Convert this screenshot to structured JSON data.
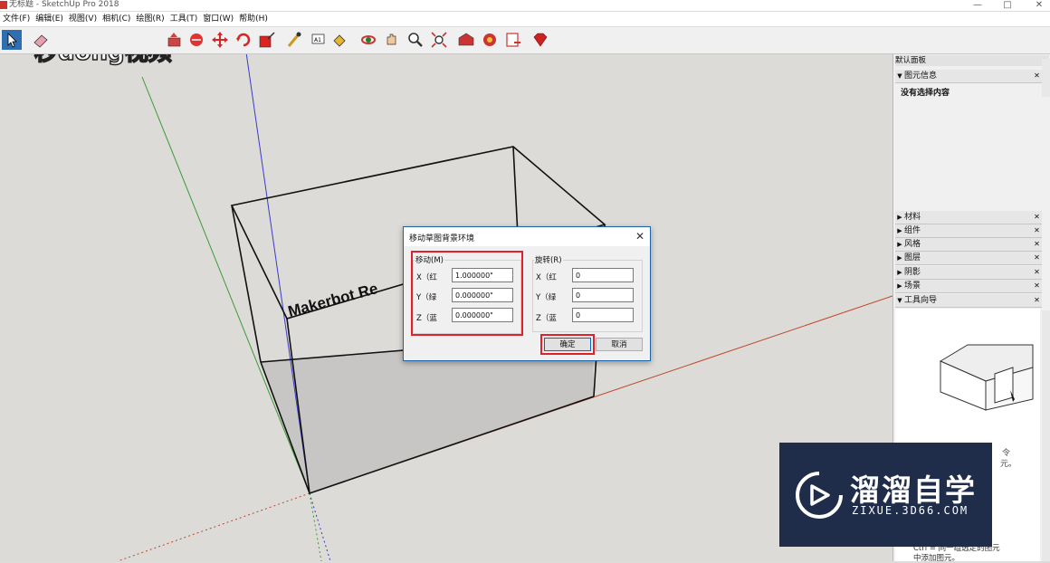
{
  "window": {
    "title": "无标题 - SketchUp Pro 2018",
    "controls": {
      "minimize": "—",
      "maximize": "□",
      "close": "✕"
    }
  },
  "menubar": {
    "items": [
      "文件(F)",
      "编辑(E)",
      "视图(V)",
      "相机(C)",
      "绘图(R)",
      "工具(T)",
      "窗口(W)",
      "帮助(H)"
    ]
  },
  "toolbar": {
    "tools": [
      "select",
      "eraser",
      "line",
      "arc",
      "push-pull",
      "move",
      "rotate",
      "scale",
      "tape",
      "text",
      "paint",
      "orbit",
      "pan",
      "zoom",
      "zoom-extents",
      "warehouse",
      "extensions",
      "send",
      "ruby"
    ]
  },
  "logo_left": {
    "text": "秒dong视频"
  },
  "model": {
    "label": "Makerbot Re"
  },
  "panel": {
    "tray_title": "默认面板",
    "entity_info": {
      "title": "图元信息",
      "message": "没有选择内容"
    },
    "collapsed": [
      "材料",
      "组件",
      "风格",
      "图层",
      "阴影",
      "场景"
    ],
    "instructor": {
      "title": "工具向导",
      "text_line1": "Ctrl = 同一组选定的图元",
      "text_line2": "中添加图元。",
      "fragment1": "令",
      "fragment2": "元。"
    }
  },
  "dialog": {
    "title": "移动草图背景环境",
    "close": "✕",
    "move": {
      "label": "移动(M)",
      "x_label": "X（红",
      "x_value": "1.000000\"",
      "y_label": "Y（绿",
      "y_value": "0.000000\"",
      "z_label": "Z（蓝",
      "z_value": "0.000000\""
    },
    "rotate": {
      "label": "旋转(R)",
      "x_label": "X（红",
      "x_value": "0",
      "y_label": "Y（绿",
      "y_value": "0",
      "z_label": "Z（蓝",
      "z_value": "0"
    },
    "ok": "确定",
    "cancel": "取消"
  },
  "brand": {
    "name": "溜溜自学",
    "url": "ZIXUE.3D66.COM"
  },
  "colors": {
    "accent": "#2f6fb0",
    "highlight": "#e2202b",
    "brand_bg": "#1f2d4b",
    "axis_red": "#c0482a",
    "axis_green": "#3a9a3a",
    "axis_blue": "#3a3acc"
  }
}
